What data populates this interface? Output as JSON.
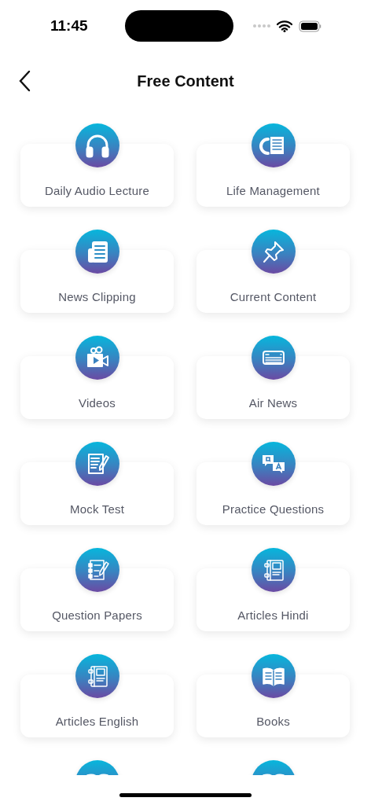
{
  "status_bar": {
    "time": "11:45"
  },
  "header": {
    "title": "Free Content"
  },
  "items": [
    {
      "kind": "tile",
      "label": "Daily Audio Lecture"
    },
    {
      "kind": "tile",
      "label": "Life Management"
    },
    {
      "kind": "tile",
      "label": "News Clipping"
    },
    {
      "kind": "tile",
      "label": "Current Content"
    },
    {
      "kind": "tile",
      "label": "Videos"
    },
    {
      "kind": "tile",
      "label": "Air News"
    },
    {
      "kind": "tile",
      "label": "Mock Test"
    },
    {
      "kind": "tile",
      "label": "Practice Questions"
    },
    {
      "kind": "tile",
      "label": "Question Papers"
    },
    {
      "kind": "tile",
      "label": "Articles Hindi"
    },
    {
      "kind": "tile",
      "label": "Articles English"
    },
    {
      "kind": "tile",
      "label": "Books"
    },
    {
      "kind": "partial"
    },
    {
      "kind": "partial"
    }
  ]
}
